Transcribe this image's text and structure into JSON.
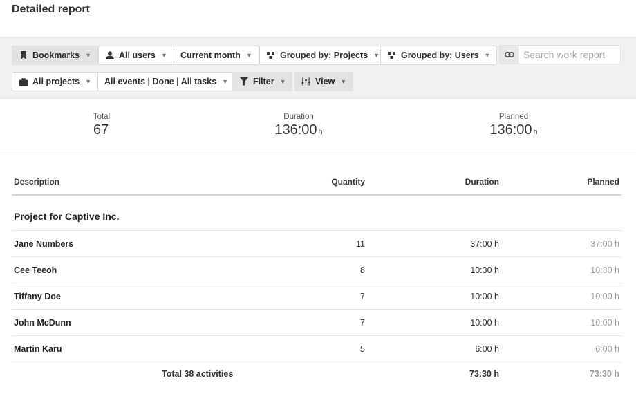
{
  "page": {
    "title": "Detailed report"
  },
  "toolbar": {
    "bookmarks": "Bookmarks",
    "all_users": "All users",
    "current_month": "Current month",
    "grouped_projects": "Grouped by: Projects",
    "grouped_users": "Grouped by: Users",
    "search_placeholder": "Search work report",
    "all_projects": "All projects",
    "all_events": "All events | Done | All tasks",
    "filter": "Filter",
    "view": "View"
  },
  "icons": {
    "bookmark": "bookmark-icon",
    "user": "user-icon",
    "group": "group-tree-icon",
    "link": "link-icon",
    "briefcase": "briefcase-icon",
    "filter": "funnel-icon",
    "view": "sliders-icon",
    "caret": "chevron-down-icon"
  },
  "stats": {
    "total_label": "Total",
    "total_value": "67",
    "duration_label": "Duration",
    "duration_value": "136:00",
    "duration_unit": "h",
    "planned_label": "Planned",
    "planned_value": "136:00",
    "planned_unit": "h"
  },
  "table": {
    "headers": {
      "description": "Description",
      "quantity": "Quantity",
      "duration": "Duration",
      "planned": "Planned"
    },
    "group": {
      "name": "Project for Captive Inc."
    },
    "rows": [
      {
        "name": "Jane Numbers",
        "quantity": "11",
        "duration": "37:00 h",
        "planned": "37:00 h"
      },
      {
        "name": "Cee Teeoh",
        "quantity": "8",
        "duration": "10:30 h",
        "planned": "10:30 h"
      },
      {
        "name": "Tiffany Doe",
        "quantity": "7",
        "duration": "10:00 h",
        "planned": "10:00 h"
      },
      {
        "name": "John McDunn",
        "quantity": "7",
        "duration": "10:00 h",
        "planned": "10:00 h"
      },
      {
        "name": "Martin Karu",
        "quantity": "5",
        "duration": "6:00 h",
        "planned": "6:00 h"
      }
    ],
    "total": {
      "label": "Total 38 activities",
      "duration": "73:30 h",
      "planned": "73:30 h"
    }
  },
  "colors": {
    "toolbar_bg": "#f1f1f1",
    "planned_text": "#9a9a9a"
  }
}
